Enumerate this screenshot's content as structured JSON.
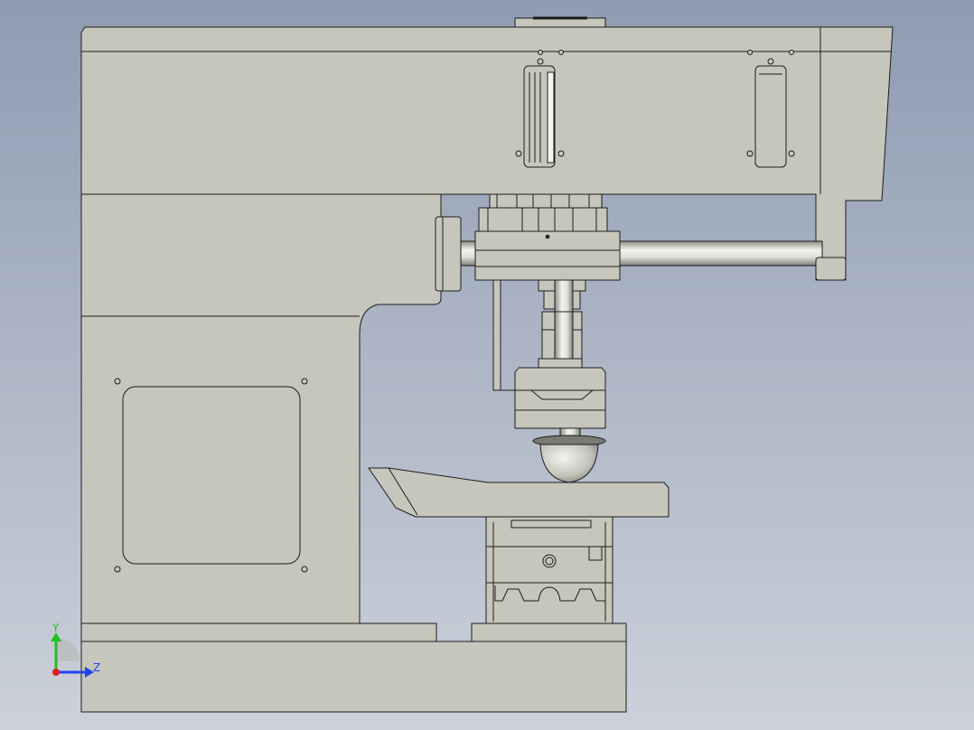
{
  "viewport": {
    "background_top": "#8e9cb1",
    "background_bottom": "#ccd1da"
  },
  "model": {
    "body_fill": "#c6c6bc",
    "body_shade": "#b5b5ab",
    "edge_color": "#1d1d1d",
    "metal_light": "#f2f2ee",
    "metal_dark": "#8d8d86"
  },
  "triad": {
    "y_label": "Y",
    "z_label": "Z",
    "y_color": "#22c022",
    "z_color": "#2244ee",
    "origin_color": "#e02020"
  }
}
